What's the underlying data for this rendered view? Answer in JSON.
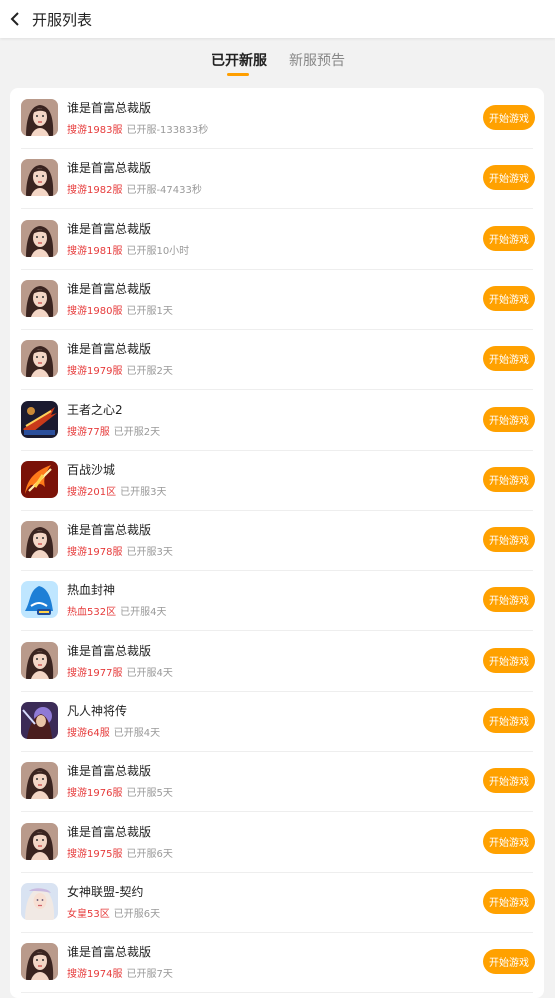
{
  "header": {
    "title": "开服列表"
  },
  "tabs": [
    {
      "label": "已开新服",
      "active": true
    },
    {
      "label": "新服预告",
      "active": false
    }
  ],
  "colors": {
    "accent": "#ffa100",
    "server_text": "#e63a3a",
    "muted": "#999999"
  },
  "rows": [
    {
      "name": "谁是首富总裁版",
      "server": "搜游1983服",
      "opened": "已开服-133833秒",
      "button": "开始游戏",
      "icon": "woman-portrait-icon"
    },
    {
      "name": "谁是首富总裁版",
      "server": "搜游1982服",
      "opened": "已开服-47433秒",
      "button": "开始游戏",
      "icon": "woman-portrait-icon"
    },
    {
      "name": "谁是首富总裁版",
      "server": "搜游1981服",
      "opened": "已开服10小时",
      "button": "开始游戏",
      "icon": "woman-portrait-icon"
    },
    {
      "name": "谁是首富总裁版",
      "server": "搜游1980服",
      "opened": "已开服1天",
      "button": "开始游戏",
      "icon": "woman-portrait-icon"
    },
    {
      "name": "谁是首富总裁版",
      "server": "搜游1979服",
      "opened": "已开服2天",
      "button": "开始游戏",
      "icon": "woman-portrait-icon"
    },
    {
      "name": "王者之心2",
      "server": "搜游77服",
      "opened": "已开服2天",
      "button": "开始游戏",
      "icon": "dragon-warrior-icon"
    },
    {
      "name": "百战沙城",
      "server": "搜游201区",
      "opened": "已开服3天",
      "button": "开始游戏",
      "icon": "fire-sword-icon"
    },
    {
      "name": "谁是首富总裁版",
      "server": "搜游1978服",
      "opened": "已开服3天",
      "button": "开始游戏",
      "icon": "woman-portrait-icon"
    },
    {
      "name": "热血封神",
      "server": "热血532区",
      "opened": "已开服4天",
      "button": "开始游戏",
      "icon": "blue-warrior-icon"
    },
    {
      "name": "谁是首富总裁版",
      "server": "搜游1977服",
      "opened": "已开服4天",
      "button": "开始游戏",
      "icon": "woman-portrait-icon"
    },
    {
      "name": "凡人神将传",
      "server": "搜游64服",
      "opened": "已开服4天",
      "button": "开始游戏",
      "icon": "hero-portrait-icon"
    },
    {
      "name": "谁是首富总裁版",
      "server": "搜游1976服",
      "opened": "已开服5天",
      "button": "开始游戏",
      "icon": "woman-portrait-icon"
    },
    {
      "name": "谁是首富总裁版",
      "server": "搜游1975服",
      "opened": "已开服6天",
      "button": "开始游戏",
      "icon": "woman-portrait-icon"
    },
    {
      "name": "女神联盟-契约",
      "server": "女皇53区",
      "opened": "已开服6天",
      "button": "开始游戏",
      "icon": "goddess-portrait-icon"
    },
    {
      "name": "谁是首富总裁版",
      "server": "搜游1974服",
      "opened": "已开服7天",
      "button": "开始游戏",
      "icon": "woman-portrait-icon"
    }
  ]
}
